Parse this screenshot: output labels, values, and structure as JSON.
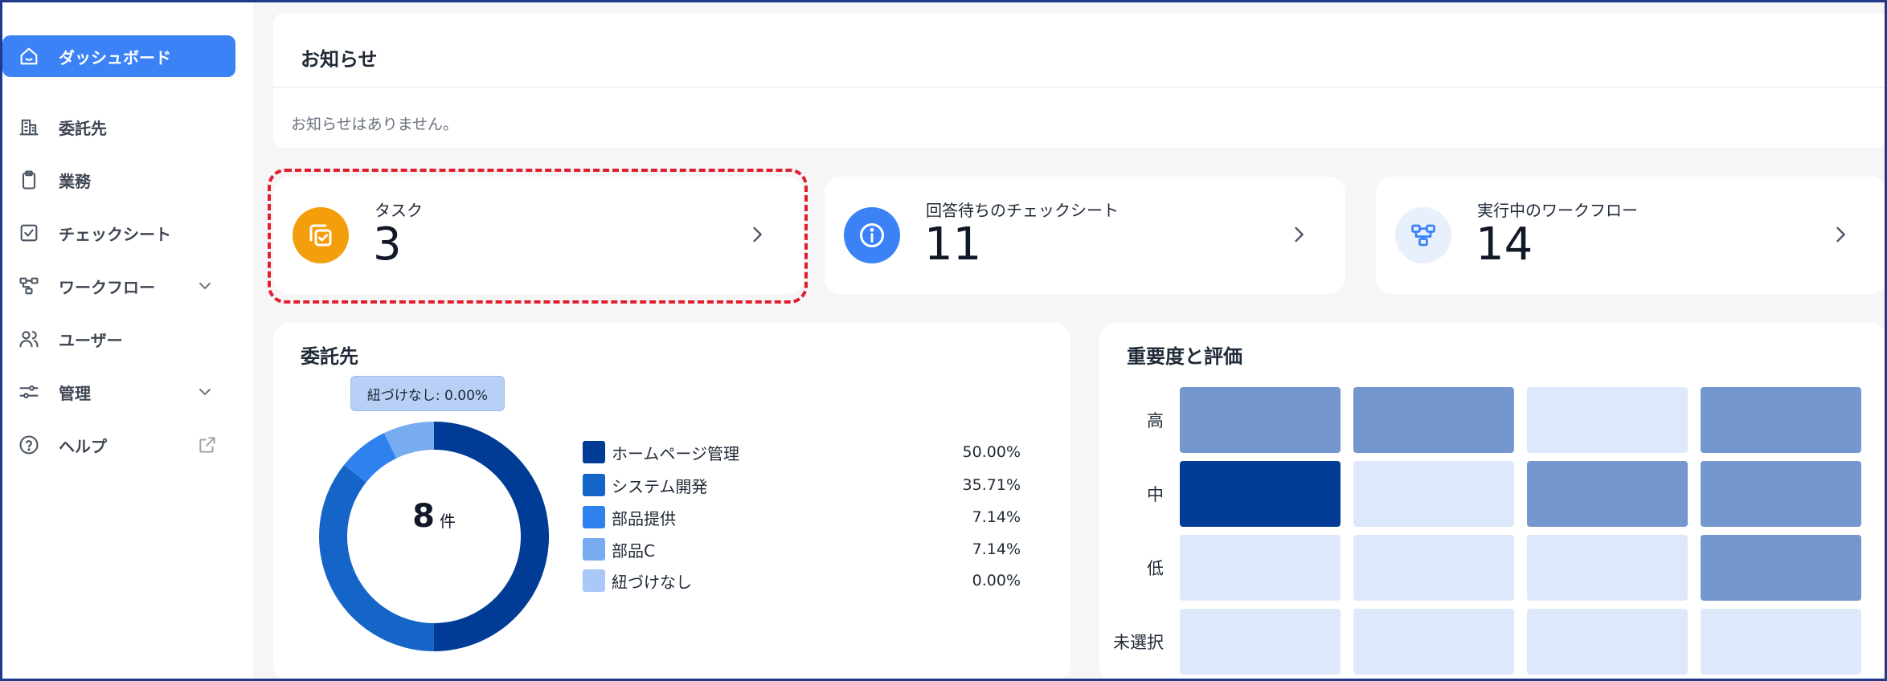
{
  "sidebar": {
    "items": [
      {
        "label": "ダッシュボード",
        "icon": "home-icon",
        "active": true
      },
      {
        "label": "委託先",
        "icon": "building-icon"
      },
      {
        "label": "業務",
        "icon": "clipboard-icon"
      },
      {
        "label": "チェックシート",
        "icon": "checkbox-icon"
      },
      {
        "label": "ワークフロー",
        "icon": "workflow-icon",
        "chevron": "chevron-down-icon"
      },
      {
        "label": "ユーザー",
        "icon": "users-icon"
      },
      {
        "label": "管理",
        "icon": "settings-sliders-icon",
        "chevron": "chevron-down-icon"
      },
      {
        "label": "ヘルプ",
        "icon": "help-circle-icon",
        "external": "external-link-icon"
      }
    ]
  },
  "notice": {
    "title": "お知らせ",
    "empty_text": "お知らせはありません。"
  },
  "stats": [
    {
      "label": "タスク",
      "value": "3",
      "icon": "copy-check-icon",
      "color": "#f59e0b"
    },
    {
      "label": "回答待ちのチェックシート",
      "value": "11",
      "icon": "info-icon",
      "color": "#3b82f6"
    },
    {
      "label": "実行中のワークフロー",
      "value": "14",
      "icon": "workflow-icon",
      "color": "#e8f0fd"
    }
  ],
  "contractors": {
    "title": "委託先",
    "tooltip": "紐づけなし: 0.00%",
    "center_value": "8",
    "center_unit": "件"
  },
  "importance": {
    "title": "重要度と評価"
  },
  "chart_data": [
    {
      "type": "pie",
      "categories": [
        "ホームページ管理",
        "システム開発",
        "部品提供",
        "部品C",
        "紐づけなし"
      ],
      "values": [
        50.0,
        35.71,
        7.14,
        7.14,
        0.0
      ],
      "labels": [
        "50.00%",
        "35.71%",
        "7.14%",
        "7.14%",
        "0.00%"
      ],
      "colors": [
        "#003c96",
        "#1565c8",
        "#2f82ee",
        "#78abf0",
        "#a9c8f7"
      ],
      "legend_position": "right"
    },
    {
      "type": "heatmap",
      "rows": [
        "高",
        "中",
        "低",
        "未選択"
      ],
      "columns": 4,
      "levels": [
        [
          2,
          2,
          1,
          2
        ],
        [
          3,
          1,
          2,
          2
        ],
        [
          1,
          1,
          1,
          2
        ],
        [
          1,
          1,
          1,
          1
        ]
      ],
      "level_colors": {
        "1": "#dde9fb",
        "2": "#7497cd",
        "3": "#003c96"
      }
    }
  ]
}
